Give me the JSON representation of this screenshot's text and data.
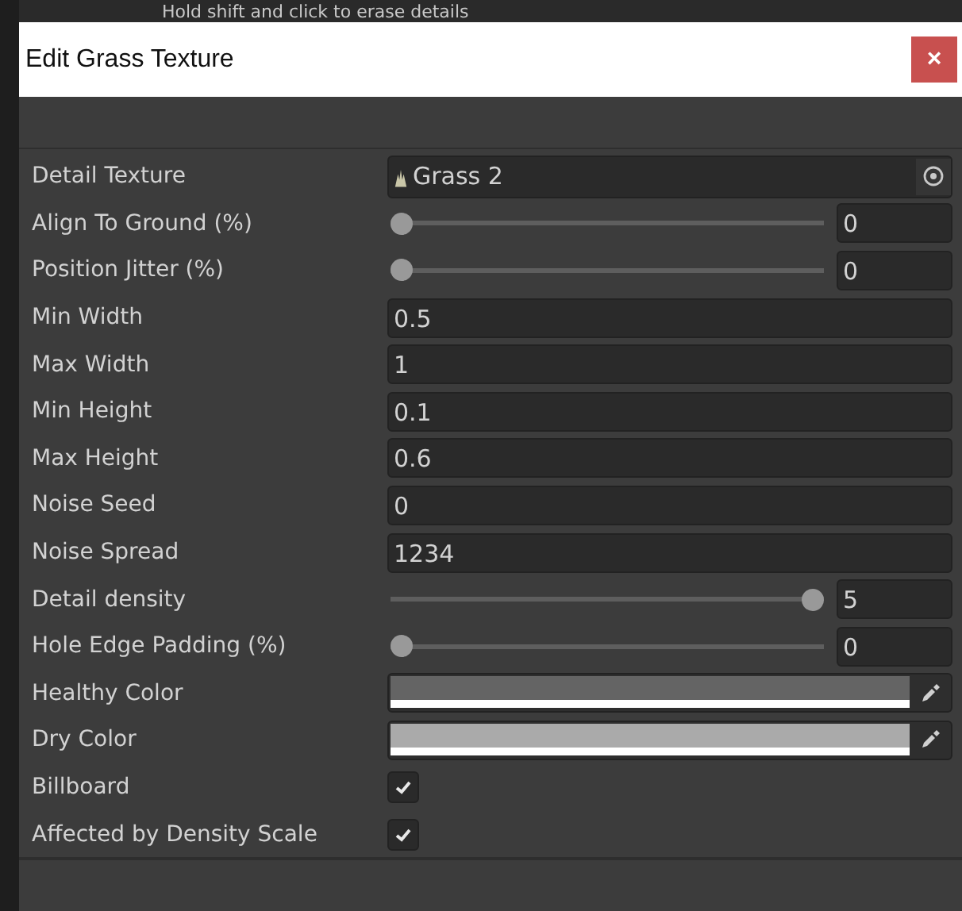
{
  "background_hint": "Hold shift and click to erase details",
  "window": {
    "title": "Edit Grass Texture",
    "close": "×"
  },
  "fields": [
    {
      "kind": "object",
      "label": "Detail Texture",
      "value": "Grass 2"
    },
    {
      "kind": "slider",
      "label": "Align To Ground (%)",
      "level": 0,
      "value": "0"
    },
    {
      "kind": "slider",
      "label": "Position Jitter (%)",
      "level": 0,
      "value": "0"
    },
    {
      "kind": "number",
      "label": "Min Width",
      "value": "0.5"
    },
    {
      "kind": "number",
      "label": "Max Width",
      "value": "1"
    },
    {
      "kind": "number",
      "label": "Min Height",
      "value": "0.1"
    },
    {
      "kind": "number",
      "label": "Max Height",
      "value": "0.6"
    },
    {
      "kind": "number",
      "label": "Noise Seed",
      "value": "0"
    },
    {
      "kind": "number",
      "label": "Noise Spread",
      "value": "1234"
    },
    {
      "kind": "slider",
      "label": "Detail density",
      "level": 1,
      "value": "5"
    },
    {
      "kind": "slider",
      "label": "Hole Edge Padding (%)",
      "level": 0,
      "value": "0"
    },
    {
      "kind": "color",
      "label": "Healthy Color",
      "color": "#646464"
    },
    {
      "kind": "color",
      "label": "Dry Color",
      "color": "#aaaaaa"
    },
    {
      "kind": "toggle",
      "label": "Billboard",
      "checked": true
    },
    {
      "kind": "toggle",
      "label": "Affected by Density Scale",
      "checked": true
    }
  ]
}
